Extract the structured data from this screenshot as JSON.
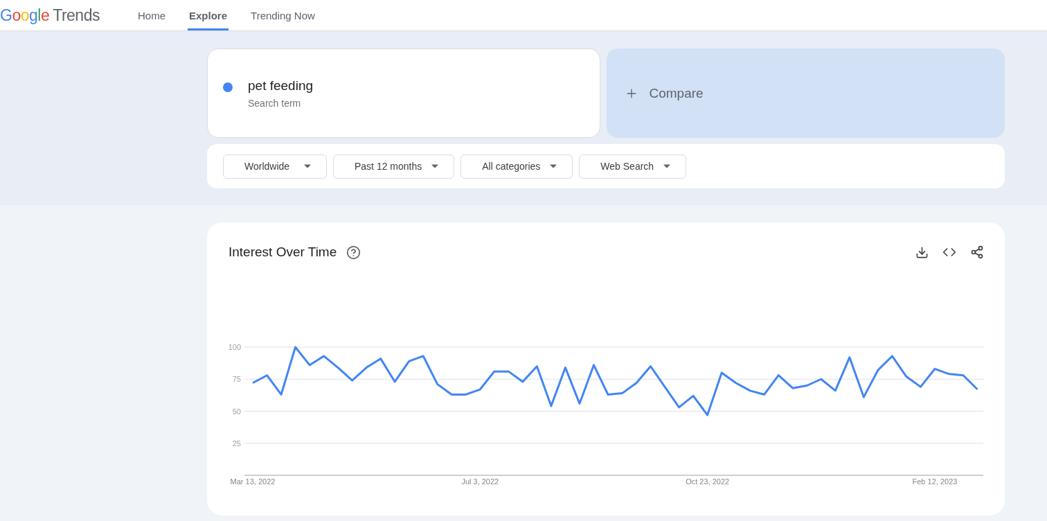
{
  "logo": {
    "brand": "Google",
    "product": "Trends"
  },
  "nav": [
    {
      "label": "Home",
      "selected": false
    },
    {
      "label": "Explore",
      "selected": true
    },
    {
      "label": "Trending Now",
      "selected": false
    }
  ],
  "search_term": {
    "term": "pet feeding",
    "type": "Search term",
    "color": "#4285f4"
  },
  "compare": {
    "label": "Compare"
  },
  "filters": [
    "Worldwide",
    "Past 12 months",
    "All categories",
    "Web Search"
  ],
  "interest_over_time": {
    "title": "Interest Over Time",
    "chart_data": {
      "type": "line",
      "categories": [
        "Mar 13, 2022",
        null,
        null,
        null,
        null,
        null,
        null,
        null,
        null,
        null,
        null,
        null,
        null,
        null,
        null,
        null,
        "Jul 3, 2022",
        null,
        null,
        null,
        null,
        null,
        null,
        null,
        null,
        null,
        null,
        null,
        null,
        null,
        null,
        null,
        "Oct 23, 2022",
        null,
        null,
        null,
        null,
        null,
        null,
        null,
        null,
        null,
        null,
        null,
        null,
        null,
        null,
        null,
        "Feb 12, 2023",
        null,
        null,
        null
      ],
      "series": [
        {
          "color": "#4285f4",
          "values": [
            72,
            78,
            63,
            100,
            86,
            93,
            84,
            74,
            84,
            91,
            73,
            89,
            93,
            71,
            63,
            63,
            67,
            81,
            81,
            73,
            85,
            54,
            84,
            56,
            86,
            63,
            64,
            72,
            85,
            69,
            53,
            62,
            47,
            80,
            72,
            66,
            63,
            78,
            68,
            70,
            75,
            66,
            92,
            61,
            82,
            93,
            77,
            69,
            83,
            79,
            78,
            67
          ]
        }
      ],
      "ylim": [
        0,
        100
      ],
      "yticks": [
        25,
        50,
        75,
        100
      ],
      "grid": true
    }
  }
}
